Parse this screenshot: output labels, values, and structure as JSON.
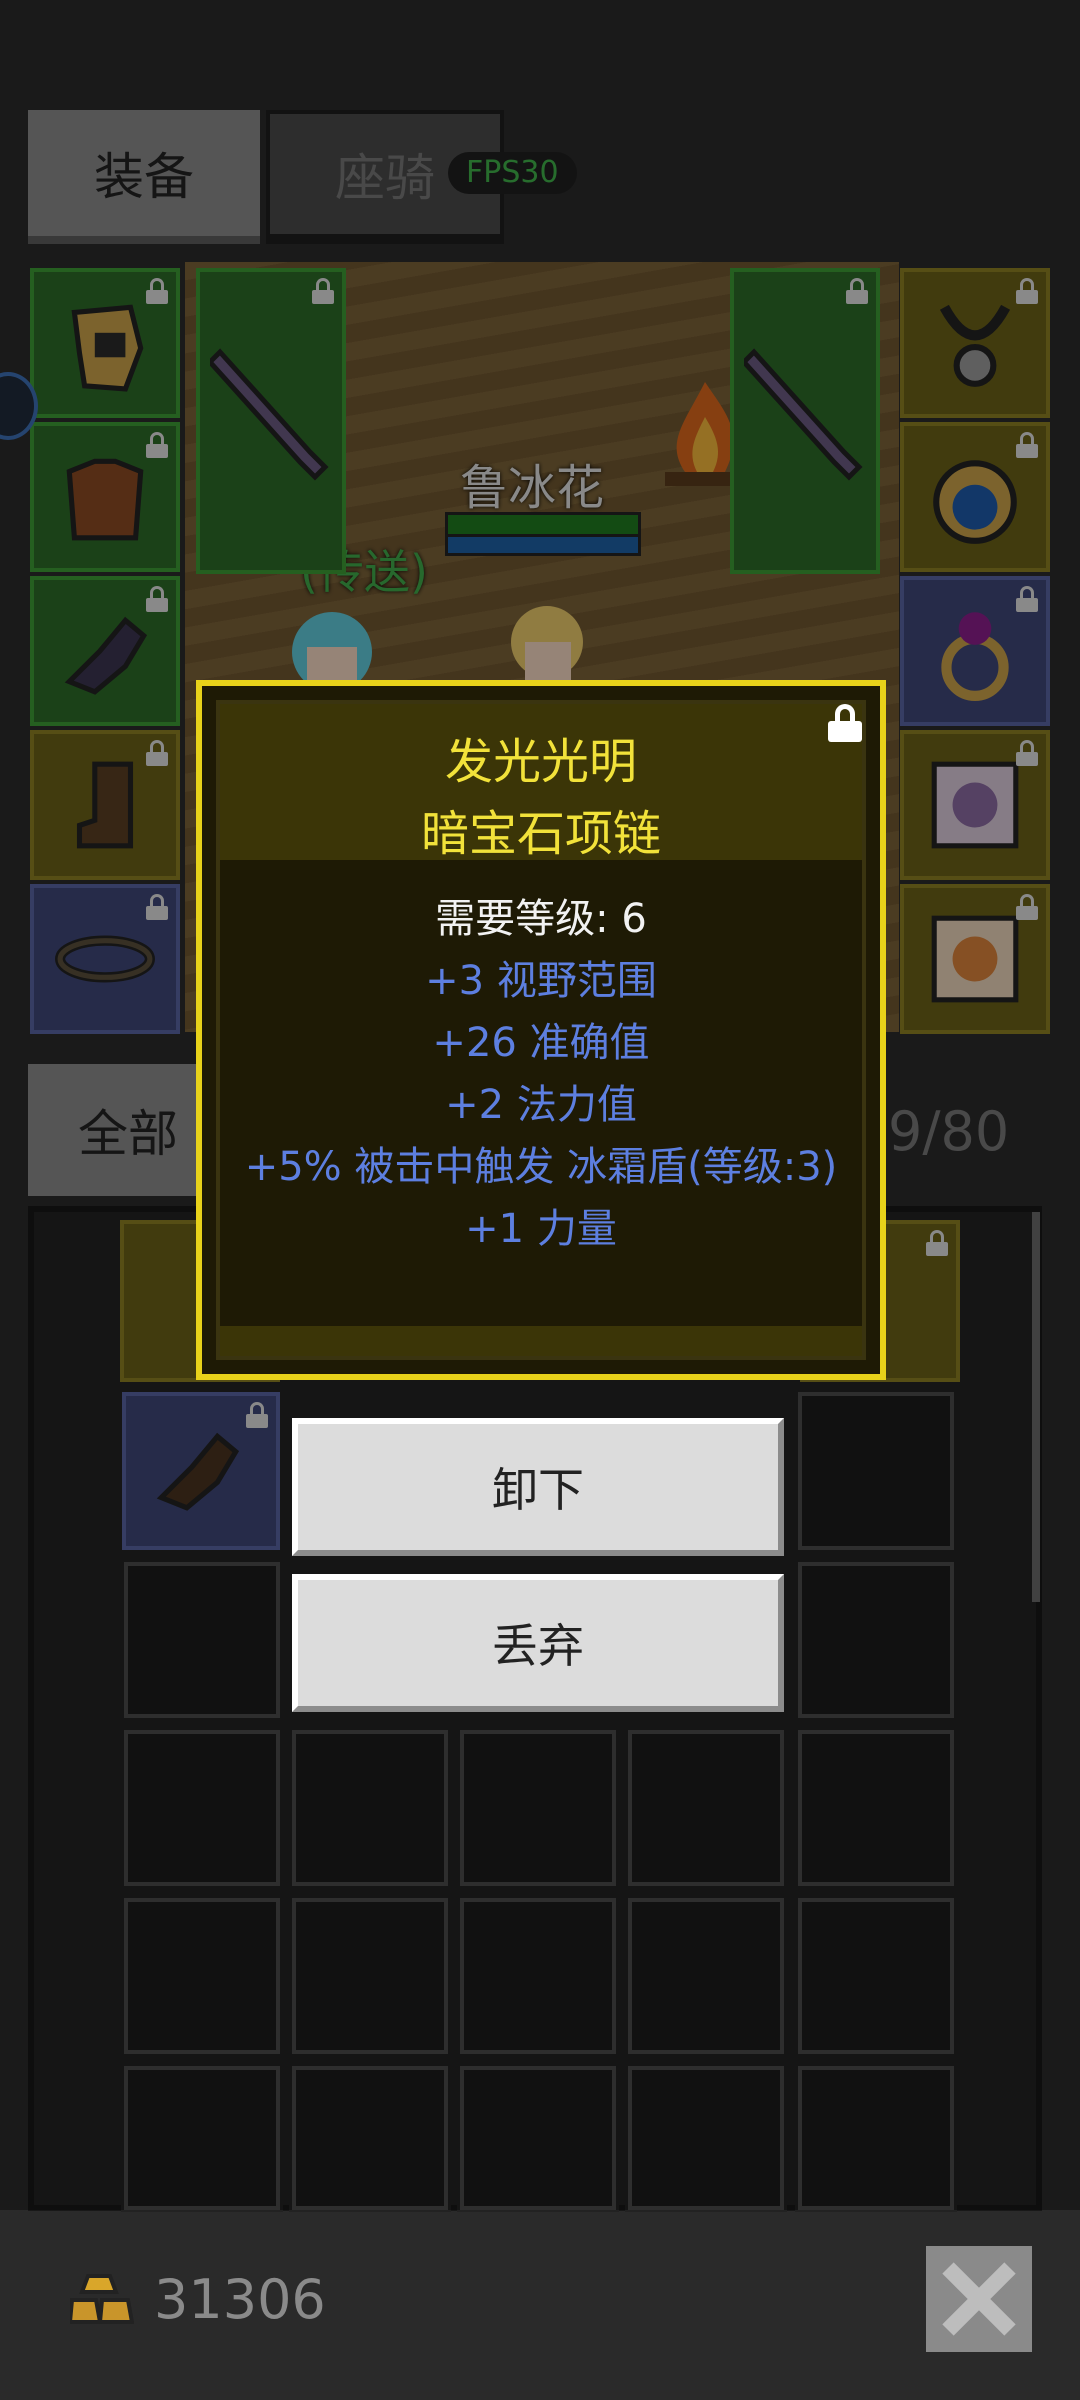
{
  "tabs": {
    "equipment": "装备",
    "mount": "座骑",
    "fps": "FPS30"
  },
  "scene": {
    "player_name": "鲁冰花",
    "npc_label": "(传送)"
  },
  "inventory": {
    "filter_label": "全部",
    "capacity": "9/80"
  },
  "tooltip": {
    "title_line1": "发光光明",
    "title_line2": "暗宝石项链",
    "required_level": "需要等级: 6",
    "stats": [
      "+3 视野范围",
      "+26 准确值",
      "+2 法力值",
      "+5% 被击中触发 冰霜盾(等级:3)",
      "+1 力量"
    ]
  },
  "actions": {
    "unequip": "卸下",
    "discard": "丢弃"
  },
  "footer": {
    "gold": "31306"
  },
  "colors": {
    "title_yellow": "#f2e23a",
    "stat_blue": "#5d7fe0",
    "slot_green": "#2c6a27",
    "slot_gold": "#6a6018",
    "slot_blue": "#3e4676"
  },
  "icons": {
    "helmet": "helmet-icon",
    "armor": "chest-armor-icon",
    "gloves": "gloves-icon",
    "boots": "boots-icon",
    "belt": "belt-icon",
    "sword": "sword-icon",
    "necklace": "necklace-icon",
    "sapphire_amulet": "sapphire-amulet-icon",
    "ring": "ring-icon",
    "pet_card": "pet-card-icon",
    "lock": "lock-icon",
    "gold": "gold-coins-icon",
    "close": "close-icon"
  }
}
